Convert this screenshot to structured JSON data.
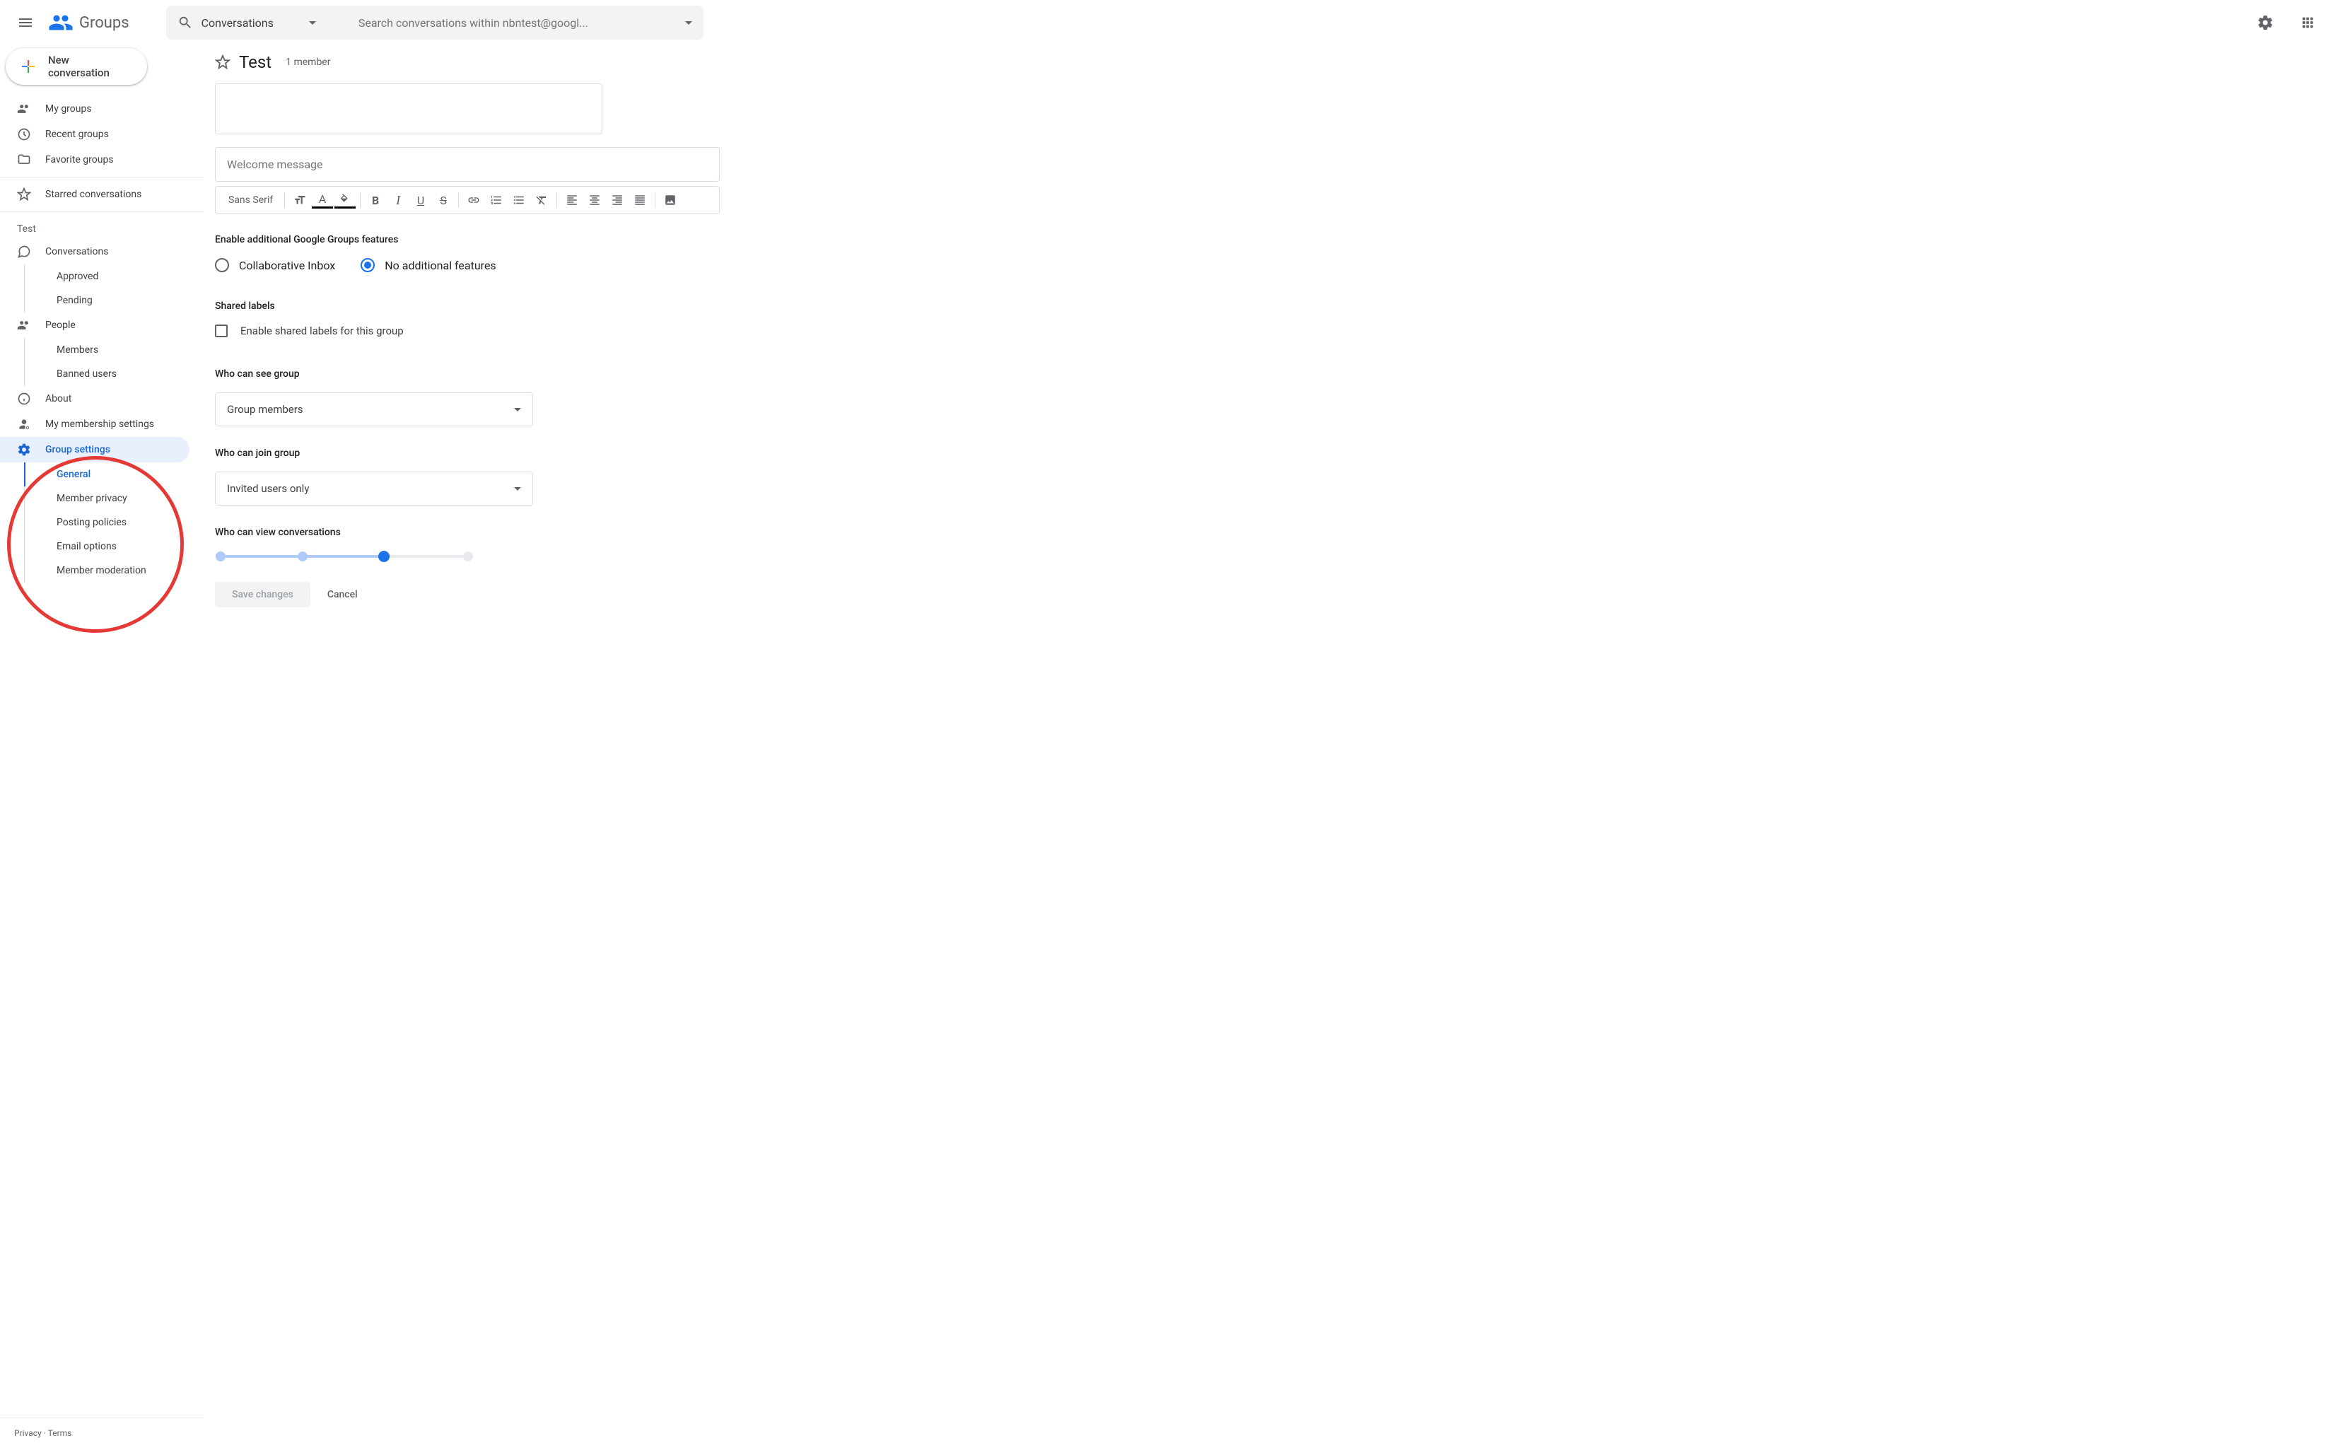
{
  "header": {
    "product_name": "Groups",
    "search_scope": "Conversations",
    "search_placeholder": "Search conversations within nbntest@googl...",
    "new_conversation_label": "New conversation"
  },
  "sidebar": {
    "primary": [
      {
        "icon": "groups",
        "label": "My groups"
      },
      {
        "icon": "clock",
        "label": "Recent groups"
      },
      {
        "icon": "folder",
        "label": "Favorite groups"
      }
    ],
    "starred_label": "Starred conversations",
    "group_section_label": "Test",
    "group_nav": {
      "conversations": "Conversations",
      "approved": "Approved",
      "pending": "Pending",
      "people": "People",
      "members": "Members",
      "banned": "Banned users",
      "about": "About",
      "membership_settings": "My membership settings",
      "group_settings": "Group settings",
      "settings_sub": [
        "General",
        "Member privacy",
        "Posting policies",
        "Email options",
        "Member moderation"
      ]
    },
    "footer": {
      "privacy": "Privacy",
      "dot": " · ",
      "terms": "Terms"
    }
  },
  "main": {
    "title": "Test",
    "member_count": "1 member",
    "welcome_placeholder": "Welcome message",
    "toolbar": {
      "font": "Sans Serif"
    },
    "features": {
      "title": "Enable additional Google Groups features",
      "collab": "Collaborative Inbox",
      "none": "No additional features",
      "selected": "none"
    },
    "shared_labels": {
      "title": "Shared labels",
      "checkbox_label": "Enable shared labels for this group"
    },
    "who_see": {
      "title": "Who can see group",
      "value": "Group members"
    },
    "who_join": {
      "title": "Who can join group",
      "value": "Invited users only"
    },
    "who_view": {
      "title": "Who can view conversations"
    },
    "actions": {
      "save": "Save changes",
      "cancel": "Cancel"
    }
  }
}
